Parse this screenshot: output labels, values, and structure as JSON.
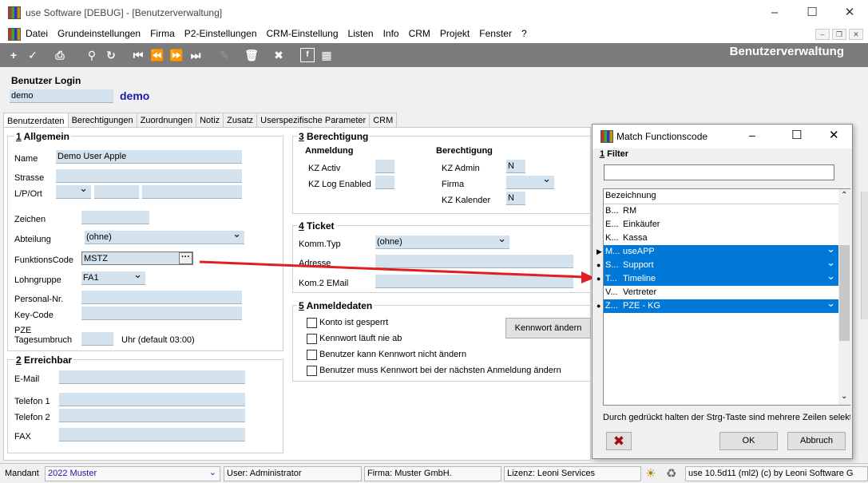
{
  "window": {
    "title": "use Software [DEBUG] - [Benutzerverwaltung]"
  },
  "menu": [
    "Datei",
    "Grundeinstellungen",
    "Firma",
    "P2-Einstellungen",
    "CRM-Einstellung",
    "Listen",
    "Info",
    "CRM",
    "Projekt",
    "Fenster",
    "?"
  ],
  "toolbar": {
    "title": "Benutzerverwaltung"
  },
  "login": {
    "heading": "Benutzer Login",
    "value": "demo",
    "display": "demo"
  },
  "tabs": [
    "Benutzerdaten",
    "Berechtigungen",
    "Zuordnungen",
    "Notiz",
    "Zusatz",
    "Userspezifische Parameter",
    "CRM"
  ],
  "allgemein": {
    "title_num": "1",
    "title": " Allgemein",
    "name_label": "Name",
    "name_value": "Demo User Apple",
    "strasse_label": "Strasse",
    "lpo_label": "L/P/Ort",
    "zeichen_label": "Zeichen",
    "abteilung_label": "Abteilung",
    "abteilung_value": "(ohne)",
    "funktion_label": "FunktionsCode",
    "funktion_value": "MSTZ",
    "funktion_btn": "···",
    "lohn_label": "Lohngruppe",
    "lohn_value": "FA1",
    "personal_label": "Personal-Nr.",
    "keycode_label": "Key-Code",
    "pze_label1": "PZE",
    "pze_label2": "Tagesumbruch",
    "pze_hint": "Uhr (default 03:00)"
  },
  "erreichbar": {
    "title_num": "2",
    "title": " Erreichbar",
    "email_label": "E-Mail",
    "tel1_label": "Telefon 1",
    "tel2_label": "Telefon 2",
    "fax_label": "FAX"
  },
  "berechtigung": {
    "title_num": "3",
    "title": " Berechtigung",
    "anmeldung": "Anmeldung",
    "kz_activ": "KZ Activ",
    "kz_log": "KZ Log Enabled",
    "berechtigung": "Berechtigung",
    "kz_admin": "KZ Admin",
    "kz_admin_value": "N",
    "firma": "Firma",
    "kz_kalender": "KZ Kalender",
    "kz_kalender_value": "N"
  },
  "ticket": {
    "title_num": "4",
    "title": " Ticket",
    "kommtyp_label": "Komm.Typ",
    "kommtyp_value": "(ohne)",
    "adresse_label": "Adresse",
    "kom2_label": "Kom.2 EMail"
  },
  "anmeldedaten": {
    "title_num": "5",
    "title": " Anmeldedaten",
    "c1": "Konto ist gesperrt",
    "c2": "Kennwort läuft nie ab",
    "c3": "Benutzer kann Kennwort nicht ändern",
    "c4": "Benutzer muss Kennwort bei der nächsten Anmeldung ändern",
    "pwd_button": "Kennwort ändern"
  },
  "dialog": {
    "title": "Match Functionscode",
    "filter_num": "1",
    "filter_label": " Filter",
    "column": "Bezeichnung",
    "rows": [
      {
        "k": "B...",
        "v": "RM",
        "sel": false,
        "mark": ""
      },
      {
        "k": "E...",
        "v": "Einkäufer",
        "sel": false,
        "mark": ""
      },
      {
        "k": "K...",
        "v": "Kassa",
        "sel": false,
        "mark": ""
      },
      {
        "k": "M...",
        "v": "useAPP",
        "sel": true,
        "mark": "▶"
      },
      {
        "k": "S...",
        "v": "Support",
        "sel": true,
        "mark": "●"
      },
      {
        "k": "T...",
        "v": "Timeline",
        "sel": true,
        "mark": "●"
      },
      {
        "k": "V...",
        "v": "Vertreter",
        "sel": false,
        "mark": ""
      },
      {
        "k": "Z...",
        "v": "PZE - KG",
        "sel": true,
        "mark": "●"
      }
    ],
    "hint": "Durch gedrückt halten der Strg-Taste sind mehrere Zeilen selekti",
    "ok": "OK",
    "cancel": "Abbruch"
  },
  "status": {
    "mandant_label": "Mandant",
    "mandant_value": "2022 Muster",
    "user": "User: Administrator",
    "firma": "Firma: Muster GmbH.",
    "lizenz": "Lizenz: Leoni Services",
    "version": "use 10.5d11 (ml2)  (c) by Leoni Software G"
  },
  "colors": {
    "selection": "#0078d7",
    "field": "#d4e2ee",
    "toolbar": "#7b7b7b",
    "arrow": "#e02020",
    "brand_blue": "#1a1aa8"
  }
}
